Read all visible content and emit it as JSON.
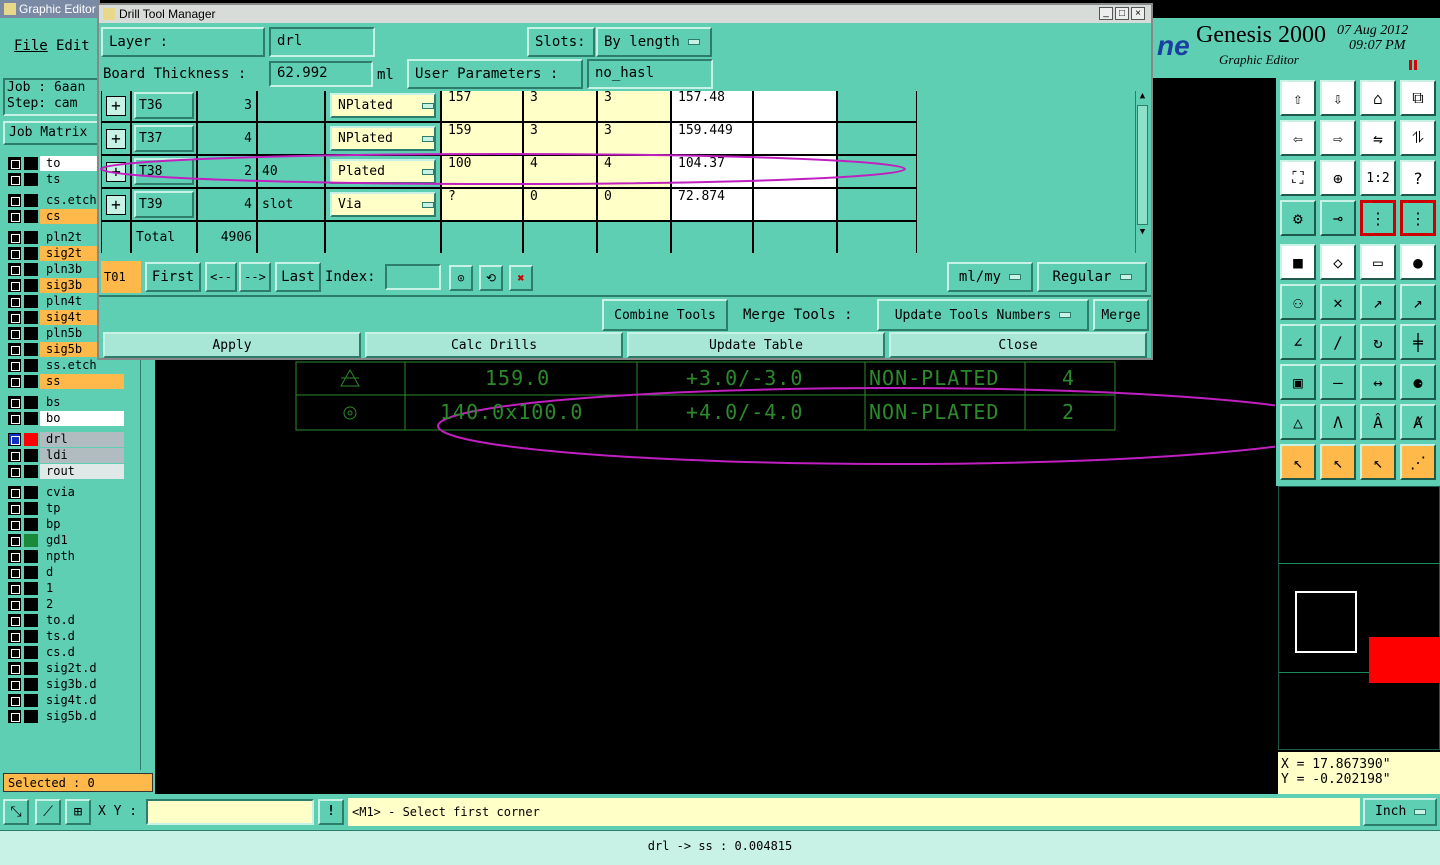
{
  "main_window": {
    "title": "Graphic Editor",
    "menu": [
      "File",
      "Edit"
    ],
    "job_label": "Job : 6aan",
    "step_label": "Step: cam",
    "job_matrix": "Job Matrix",
    "selected": "Selected : 0",
    "brand": "Genesis 2000",
    "brand_sub": "Graphic Editor",
    "brand_partial": "ne",
    "date": "07 Aug 2012",
    "time": "09:07 PM",
    "xy_label": "X Y :",
    "xy_value": "",
    "prompt": "<M1> - Select first corner",
    "units": "Inch",
    "coord_x": "X = 17.867390\"",
    "coord_y": "Y = -0.202198\"",
    "status": "drl -> ss : 0.004815"
  },
  "layers": [
    {
      "name": "to",
      "style": "white"
    },
    {
      "name": "ts",
      "style": "teal"
    },
    {
      "name": "cs.etch",
      "style": "teal"
    },
    {
      "name": "cs",
      "style": "orange"
    },
    {
      "name": "pln2t",
      "style": "teal"
    },
    {
      "name": "sig2t",
      "style": "orange"
    },
    {
      "name": "pln3b",
      "style": "teal"
    },
    {
      "name": "sig3b",
      "style": "orange"
    },
    {
      "name": "pln4t",
      "style": "teal"
    },
    {
      "name": "sig4t",
      "style": "orange"
    },
    {
      "name": "pln5b",
      "style": "teal"
    },
    {
      "name": "sig5b",
      "style": "orange"
    },
    {
      "name": "ss.etch",
      "style": "teal"
    },
    {
      "name": "ss",
      "style": "orange"
    },
    {
      "name": "bs",
      "style": "teal"
    },
    {
      "name": "bo",
      "style": "white"
    },
    {
      "name": "drl",
      "style": "grey"
    },
    {
      "name": "ldi",
      "style": "grey"
    },
    {
      "name": "rout",
      "style": "light"
    },
    {
      "name": "cvia",
      "style": "teal"
    },
    {
      "name": "tp",
      "style": "teal"
    },
    {
      "name": "bp",
      "style": "teal"
    },
    {
      "name": "gd1",
      "style": "teal"
    },
    {
      "name": "npth",
      "style": "teal"
    },
    {
      "name": "d",
      "style": "teal"
    },
    {
      "name": "1",
      "style": "teal"
    },
    {
      "name": "2",
      "style": "teal"
    },
    {
      "name": "to.d",
      "style": "teal"
    },
    {
      "name": "ts.d",
      "style": "teal"
    },
    {
      "name": "cs.d",
      "style": "teal"
    },
    {
      "name": "sig2t.d",
      "style": "teal"
    },
    {
      "name": "sig3b.d",
      "style": "teal"
    },
    {
      "name": "sig4t.d",
      "style": "teal"
    },
    {
      "name": "sig5b.d",
      "style": "teal"
    }
  ],
  "drill_dialog": {
    "title": "Drill Tool Manager",
    "layer_label": "Layer :",
    "layer_value": "drl",
    "slots_label": "Slots:",
    "slots_value": "By length",
    "thickness_label": "Board Thickness :",
    "thickness_value": "62.992",
    "thickness_unit": "ml",
    "user_params_label": "User Parameters :",
    "user_params_value": "no_hasl",
    "rows": [
      {
        "tool": "T36",
        "count": "3",
        "note": "",
        "type": "NPlated",
        "size": "157",
        "tol_plus": "3",
        "tol_minus": "3",
        "finish": "157.48",
        "extra": ""
      },
      {
        "tool": "T37",
        "count": "4",
        "note": "",
        "type": "NPlated",
        "size": "159",
        "tol_plus": "3",
        "tol_minus": "3",
        "finish": "159.449",
        "extra": ""
      },
      {
        "tool": "T38",
        "count": "2",
        "note": "40",
        "type": "Plated",
        "size": "100",
        "tol_plus": "4",
        "tol_minus": "4",
        "finish": "104.37",
        "extra": ""
      },
      {
        "tool": "T39",
        "count": "4",
        "note": "slot",
        "type": "Via",
        "size": "?",
        "tol_plus": "0",
        "tol_minus": "0",
        "finish": "72.874",
        "extra": ""
      }
    ],
    "total_label": "Total",
    "total_value": "4906",
    "current_tool": "T01",
    "nav_first": "First",
    "nav_prev": "<--",
    "nav_next": "-->",
    "nav_last": "Last",
    "index_label": "Index:",
    "index_value": "",
    "units_select": "ml/my",
    "mode_select": "Regular",
    "combine_tools": "Combine Tools",
    "merge_tools_label": "Merge Tools :",
    "merge_select": "Update Tools Numbers",
    "merge_button": "Merge",
    "apply": "Apply",
    "calc_drills": "Calc Drills",
    "update_table": "Update Table",
    "close": "Close"
  },
  "canvas_table": [
    {
      "size": "159.0",
      "tol": "+3.0/-3.0",
      "type": "NON-PLATED",
      "count": "4"
    },
    {
      "size": "140.0x100.0",
      "tol": "+4.0/-4.0",
      "type": "NON-PLATED",
      "count": "2"
    }
  ],
  "colors": {
    "teal": "#5fcfb4",
    "orange": "#ffb84a",
    "highlight": "#c020c0",
    "canvas_text": "#2c8a2c"
  }
}
